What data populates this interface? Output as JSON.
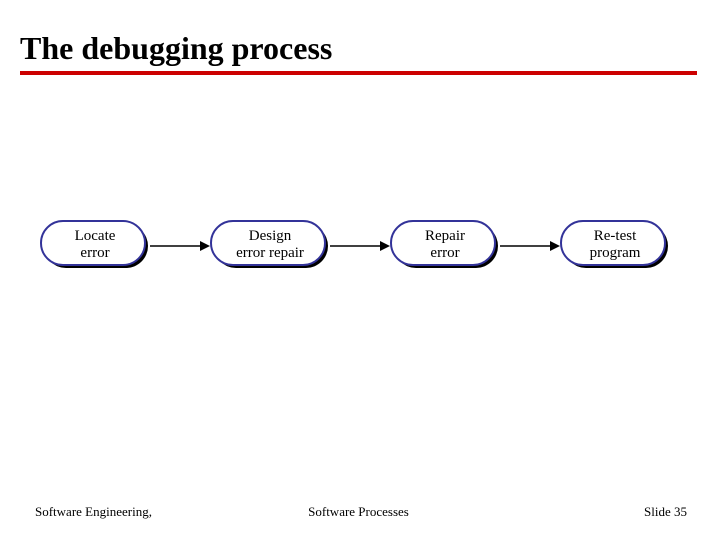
{
  "title": "The debugging process",
  "nodes": [
    {
      "line1": "Locate",
      "line2": "error"
    },
    {
      "line1": "Design",
      "line2": "error repair"
    },
    {
      "line1": "Repair",
      "line2": "error"
    },
    {
      "line1": "Re-test",
      "line2": "program"
    }
  ],
  "footer": {
    "left": "Software Engineering,",
    "center": "Software Processes",
    "right": "Slide 35"
  },
  "colors": {
    "underline": "#cc0000",
    "node_border": "#333399",
    "node_fill": "#ffffff",
    "node_shadow": "#000000",
    "arrow": "#000000"
  }
}
